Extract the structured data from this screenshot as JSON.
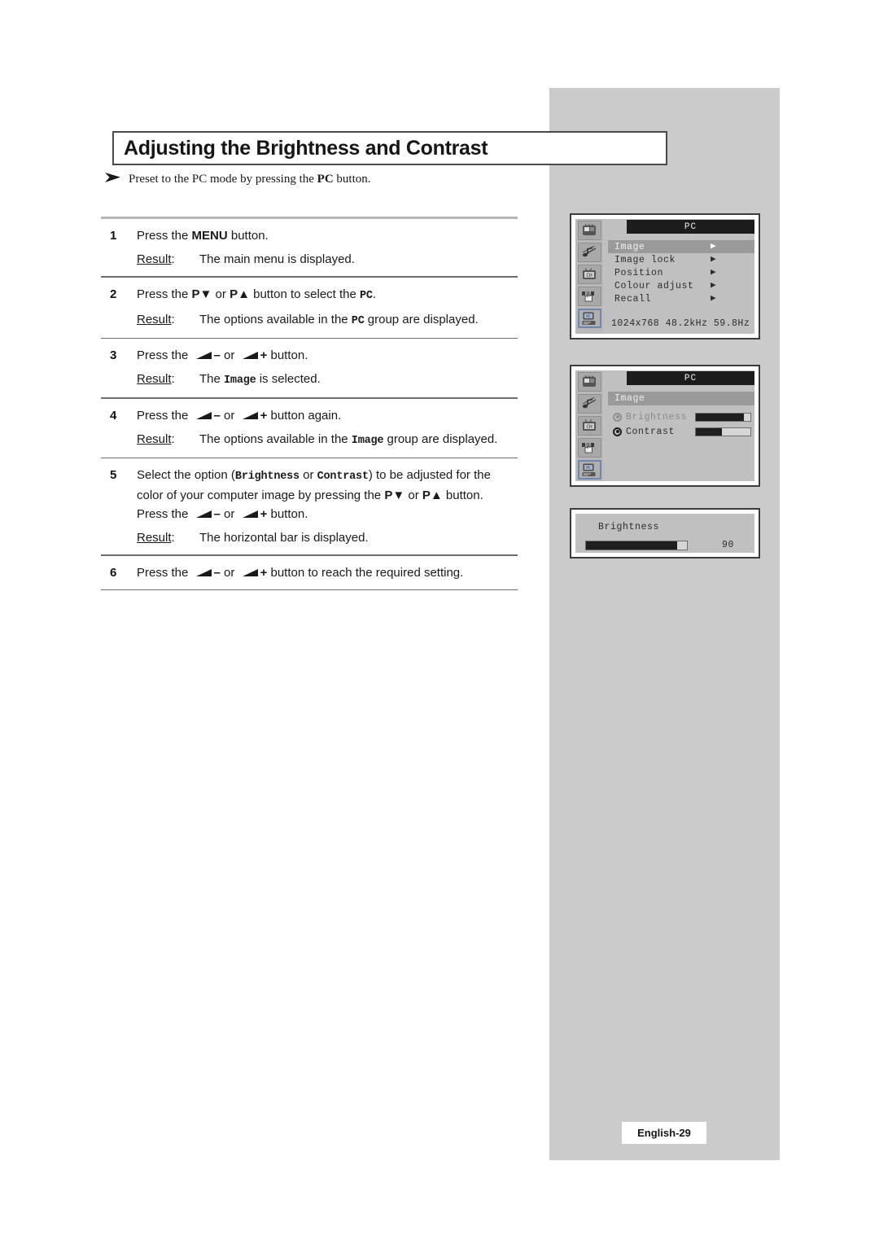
{
  "page": {
    "title": "Adjusting the Brightness and Contrast",
    "preset_arrow": "arrow-glyph",
    "preset_note_pre": "Preset to the PC mode by pressing the ",
    "preset_note_bold": "PC",
    "preset_note_post": " button.",
    "footer": "English-29"
  },
  "labels": {
    "result": "Result:",
    "or": "or",
    "minus": "–",
    "plus": "+"
  },
  "steps": [
    {
      "num": "1",
      "parts": [
        {
          "t": "Press the ",
          "s": "plain"
        },
        {
          "t": "MENU",
          "s": "bold"
        },
        {
          "t": " button.",
          "s": "plain"
        }
      ],
      "result": "The main menu is displayed."
    },
    {
      "num": "2",
      "parts": [
        {
          "t": "Press the ",
          "s": "plain"
        },
        {
          "t": "P▼",
          "s": "bold"
        },
        {
          "t": " or ",
          "s": "plain"
        },
        {
          "t": "P▲",
          "s": "bold"
        },
        {
          "t": " button to select the ",
          "s": "plain"
        },
        {
          "t": "PC",
          "s": "mono"
        },
        {
          "t": ".",
          "s": "plain"
        }
      ],
      "result_parts": [
        {
          "t": "The options available in the ",
          "s": "plain"
        },
        {
          "t": "PC",
          "s": "mono"
        },
        {
          "t": " group are displayed.",
          "s": "plain"
        }
      ]
    },
    {
      "num": "3",
      "parts": [
        {
          "t": "Press the ",
          "s": "plain"
        },
        {
          "t": "",
          "s": "vol-minus"
        },
        {
          "t": " or ",
          "s": "plain"
        },
        {
          "t": "",
          "s": "vol-plus"
        },
        {
          "t": " button.",
          "s": "plain"
        }
      ],
      "result_parts": [
        {
          "t": "The ",
          "s": "plain"
        },
        {
          "t": "Image",
          "s": "mono"
        },
        {
          "t": " is selected.",
          "s": "plain"
        }
      ]
    },
    {
      "num": "4",
      "parts": [
        {
          "t": "Press the ",
          "s": "plain"
        },
        {
          "t": "",
          "s": "vol-minus"
        },
        {
          "t": " or ",
          "s": "plain"
        },
        {
          "t": "",
          "s": "vol-plus"
        },
        {
          "t": " button again.",
          "s": "plain"
        }
      ],
      "result_parts": [
        {
          "t": "The options available in the ",
          "s": "plain"
        },
        {
          "t": "Image",
          "s": "mono"
        },
        {
          "t": " group are displayed.",
          "s": "plain"
        }
      ]
    },
    {
      "num": "5",
      "parts": [
        {
          "t": "Select the option (",
          "s": "plain"
        },
        {
          "t": "Brightness",
          "s": "mono"
        },
        {
          "t": " or ",
          "s": "plain"
        },
        {
          "t": "Contrast",
          "s": "mono"
        },
        {
          "t": ") to be adjusted for the color of your computer image by pressing the ",
          "s": "plain"
        },
        {
          "t": "P▼",
          "s": "bold"
        },
        {
          "t": " or ",
          "s": "plain"
        },
        {
          "t": "P▲",
          "s": "bold"
        },
        {
          "t": " button. Press the ",
          "s": "plain"
        },
        {
          "t": "",
          "s": "vol-minus"
        },
        {
          "t": " or ",
          "s": "plain"
        },
        {
          "t": "",
          "s": "vol-plus"
        },
        {
          "t": " button.",
          "s": "plain"
        }
      ],
      "result": "The horizontal bar is displayed."
    },
    {
      "num": "6",
      "parts": [
        {
          "t": "Press the ",
          "s": "plain"
        },
        {
          "t": "",
          "s": "vol-minus"
        },
        {
          "t": " or ",
          "s": "plain"
        },
        {
          "t": "",
          "s": "vol-plus"
        },
        {
          "t": " button to reach the required setting.",
          "s": "plain"
        }
      ]
    }
  ],
  "osd_rail_icons": [
    {
      "name": "picture-icon",
      "active": false
    },
    {
      "name": "sound-icon",
      "active": false
    },
    {
      "name": "channel-icon",
      "active": false
    },
    {
      "name": "feature-icon",
      "active": false
    },
    {
      "name": "pc-icon",
      "active": true
    }
  ],
  "osd1": {
    "header": "PC",
    "menu": [
      {
        "label": "Image",
        "arrow": "▶",
        "selected": true
      },
      {
        "label": "Image lock",
        "arrow": "▶",
        "selected": false
      },
      {
        "label": "Position",
        "arrow": "▶",
        "selected": false
      },
      {
        "label": "Colour adjust",
        "arrow": "▶",
        "selected": false
      },
      {
        "label": "Recall",
        "arrow": "▶",
        "selected": false
      }
    ],
    "footer": "1024x768  48.2kHz 59.8Hz"
  },
  "osd2": {
    "header": "PC",
    "group_title": "Image",
    "options": [
      {
        "label": "Brightness",
        "selected": false,
        "dim": true,
        "fill_pct": 88
      },
      {
        "label": "Contrast",
        "selected": true,
        "dim": false,
        "fill_pct": 48
      }
    ]
  },
  "osd3": {
    "label": "Brightness",
    "fill_pct": 90,
    "value": "90"
  },
  "colors": {
    "panel_grey": "#cbcbcb",
    "osd_body": "#c0c0c0",
    "osd_header": "#1c1c1c",
    "osd_selected": "#9a9a9a",
    "accent_blue": "#6f86ad"
  }
}
